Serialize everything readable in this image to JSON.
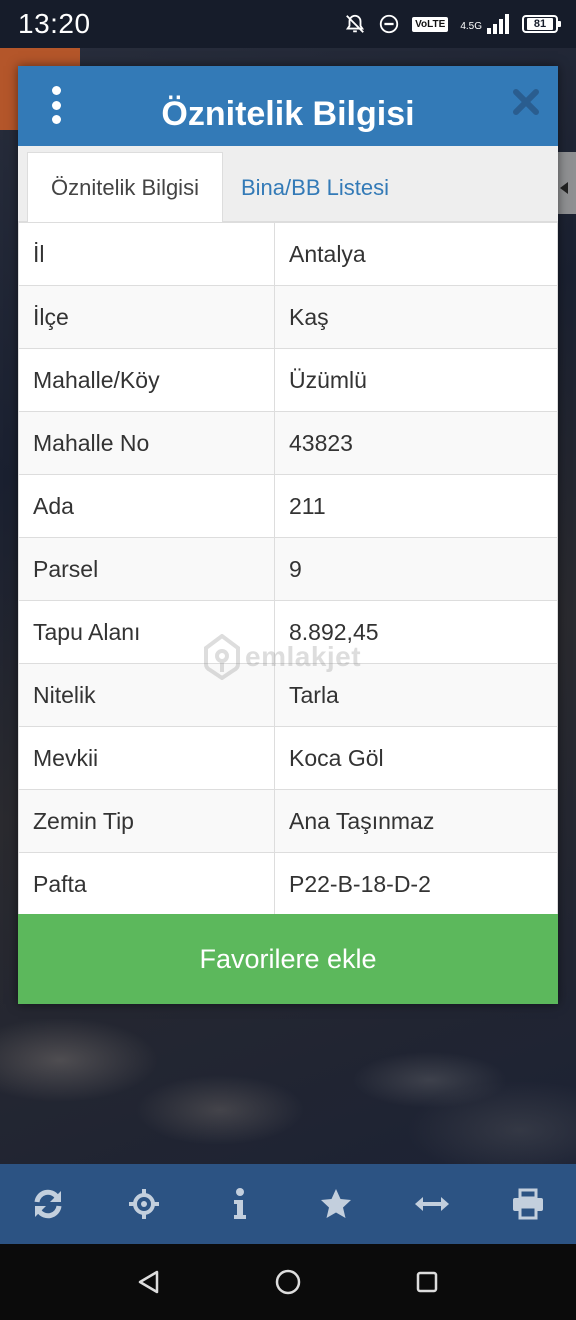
{
  "status_bar": {
    "time": "13:20",
    "volte": "VoLTE",
    "network": "4.5G",
    "battery": "81"
  },
  "modal": {
    "title": "Öznitelik Bilgisi",
    "tabs": [
      {
        "label": "Öznitelik Bilgisi",
        "active": true
      },
      {
        "label": "Bina/BB Listesi",
        "active": false
      }
    ],
    "rows": [
      {
        "key": "İl",
        "value": "Antalya"
      },
      {
        "key": "İlçe",
        "value": "Kaş"
      },
      {
        "key": "Mahalle/Köy",
        "value": "Üzümlü"
      },
      {
        "key": "Mahalle No",
        "value": "43823"
      },
      {
        "key": "Ada",
        "value": "211"
      },
      {
        "key": "Parsel",
        "value": "9"
      },
      {
        "key": "Tapu Alanı",
        "value": "8.892,45"
      },
      {
        "key": "Nitelik",
        "value": "Tarla"
      },
      {
        "key": "Mevkii",
        "value": "Koca Göl"
      },
      {
        "key": "Zemin Tip",
        "value": "Ana Taşınmaz"
      },
      {
        "key": "Pafta",
        "value": "P22-B-18-D-2"
      }
    ],
    "favorite_button": "Favorilere ekle"
  },
  "watermark": "emlakjet",
  "toolbar": {
    "icons": [
      "refresh-icon",
      "crosshair-icon",
      "info-icon",
      "star-icon",
      "measure-icon",
      "print-icon"
    ]
  },
  "colors": {
    "header": "#337ab7",
    "favorite": "#5cb85c",
    "toolbar": "#2c5383"
  }
}
